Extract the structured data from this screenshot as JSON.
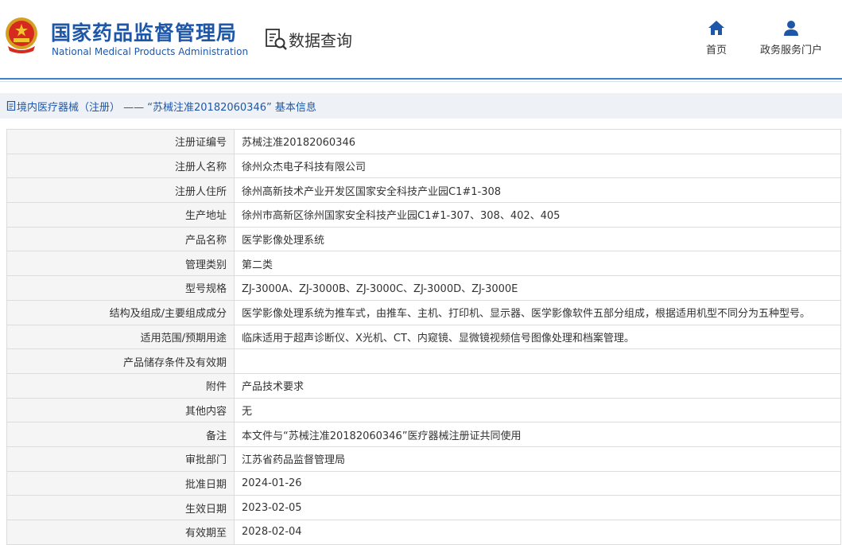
{
  "header": {
    "org_name_cn": "国家药品监督管理局",
    "org_name_en": "National Medical Products Administration",
    "query_label": "数据查询",
    "nav": [
      {
        "label": "首页",
        "icon": "home-icon"
      },
      {
        "label": "政务服务门户",
        "icon": "user-icon"
      }
    ]
  },
  "breadcrumb": "境内医疗器械（注册） —— “苏械注准20182060346” 基本信息",
  "colors": {
    "brand": "#1f57a8",
    "rule": "#3d86c6",
    "label_bg": "#f5f5f5",
    "crumb_bg": "#eef2f7"
  },
  "rows": [
    {
      "label": "注册证编号",
      "value": "苏械注准20182060346"
    },
    {
      "label": "注册人名称",
      "value": "徐州众杰电子科技有限公司"
    },
    {
      "label": "注册人住所",
      "value": "徐州高新技术产业开发区国家安全科技产业园C1#1-308"
    },
    {
      "label": "生产地址",
      "value": "徐州市高新区徐州国家安全科技产业园C1#1-307、308、402、405"
    },
    {
      "label": "产品名称",
      "value": "医学影像处理系统"
    },
    {
      "label": "管理类别",
      "value": "第二类"
    },
    {
      "label": "型号规格",
      "value": "ZJ-3000A、ZJ-3000B、ZJ-3000C、ZJ-3000D、ZJ-3000E"
    },
    {
      "label": "结构及组成/主要组成成分",
      "value": "医学影像处理系统为推车式，由推车、主机、打印机、显示器、医学影像软件五部分组成，根据适用机型不同分为五种型号。"
    },
    {
      "label": "适用范围/预期用途",
      "value": "临床适用于超声诊断仪、X光机、CT、内窥镜、显微镜视频信号图像处理和档案管理。"
    },
    {
      "label": "产品储存条件及有效期",
      "value": ""
    },
    {
      "label": "附件",
      "value": "产品技术要求"
    },
    {
      "label": "其他内容",
      "value": "无"
    },
    {
      "label": "备注",
      "value": "本文件与“苏械注准20182060346”医疗器械注册证共同使用"
    },
    {
      "label": "审批部门",
      "value": "江苏省药品监督管理局"
    },
    {
      "label": "批准日期",
      "value": "2024-01-26"
    },
    {
      "label": "生效日期",
      "value": "2023-02-05"
    },
    {
      "label": "有效期至",
      "value": "2028-02-04"
    }
  ]
}
